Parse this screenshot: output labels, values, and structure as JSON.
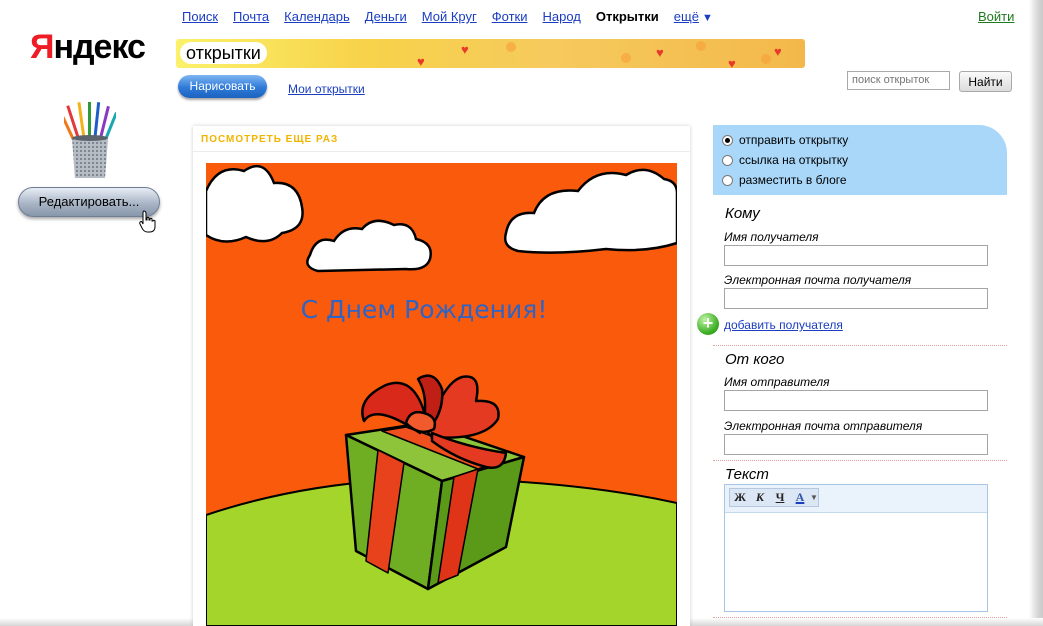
{
  "logo": {
    "first_letter": "Я",
    "rest": "ндекс"
  },
  "topnav": {
    "items": [
      {
        "label": "Поиск",
        "current": false
      },
      {
        "label": "Почта",
        "current": false
      },
      {
        "label": "Календарь",
        "current": false
      },
      {
        "label": "Деньги",
        "current": false
      },
      {
        "label": "Мой Круг",
        "current": false
      },
      {
        "label": "Фотки",
        "current": false
      },
      {
        "label": "Народ",
        "current": false
      },
      {
        "label": "Открытки",
        "current": true
      }
    ],
    "more_label": "ещё",
    "login_label": "Войти"
  },
  "banner": {
    "title": "открытки"
  },
  "actions": {
    "draw_label": "Нарисовать",
    "my_cards_label": "Мои открытки"
  },
  "search": {
    "placeholder": "поиск открыток",
    "button_label": "Найти"
  },
  "sidebar": {
    "edit_label": "Редактировать..."
  },
  "card": {
    "replay_label": "ПОСМОТРЕТЬ ЕЩЕ РАЗ",
    "greeting": "С Днем Рождения!",
    "sky_color": "#f95a0c",
    "grass_color": "#a4d52a",
    "greeting_color": "#2f63c4"
  },
  "send_options": {
    "items": [
      {
        "label": "отправить открытку",
        "selected": true
      },
      {
        "label": "ссылка на открытку",
        "selected": false
      },
      {
        "label": "разместить в блоге",
        "selected": false
      }
    ]
  },
  "to": {
    "title": "Кому",
    "name_label": "Имя получателя",
    "name_value": "",
    "email_label": "Электронная почта получателя",
    "email_value": "",
    "add_label": "добавить получателя"
  },
  "from": {
    "title": "От кого",
    "name_label": "Имя отправителя",
    "name_value": "",
    "email_label": "Электронная почта отправителя",
    "email_value": ""
  },
  "text": {
    "title": "Текст",
    "toolbar": {
      "bold": "Ж",
      "italic": "К",
      "underline": "Ч",
      "color": "A"
    },
    "value": ""
  }
}
